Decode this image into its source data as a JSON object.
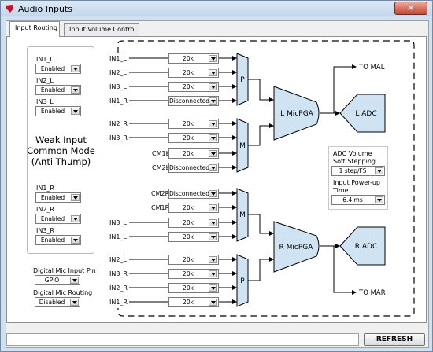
{
  "window": {
    "title": "Audio Inputs",
    "close_glyph": "✕"
  },
  "tabs": [
    {
      "label": "Input Routing",
      "active": true
    },
    {
      "label": "Input Volume Control",
      "active": false
    }
  ],
  "left_panel": {
    "channels_top": [
      {
        "label": "IN1_L",
        "value": "Enabled"
      },
      {
        "label": "IN2_L",
        "value": "Enabled"
      },
      {
        "label": "IN3_L",
        "value": "Enabled"
      }
    ],
    "weak_input_text": "Weak Input Common Mode (Anti Thump)",
    "channels_bottom": [
      {
        "label": "IN1_R",
        "value": "Enabled"
      },
      {
        "label": "IN2_R",
        "value": "Enabled"
      },
      {
        "label": "IN3_R",
        "value": "Enabled"
      }
    ],
    "digital_mic_pin": {
      "label": "Digital Mic Input Pin",
      "value": "GPIO"
    },
    "digital_mic_routing": {
      "label": "Digital Mic Routing",
      "value": "Disabled"
    }
  },
  "routing": {
    "inputs": [
      {
        "label": "IN1_L",
        "value": "20k"
      },
      {
        "label": "IN2_L",
        "value": "20k"
      },
      {
        "label": "IN3_L",
        "value": "20k"
      },
      {
        "label": "IN1_R",
        "value": "Disconnected"
      },
      {
        "label": "IN2_R",
        "value": "20k"
      },
      {
        "label": "IN3_R",
        "value": "20k"
      },
      {
        "label": "CM1L",
        "value": "20k"
      },
      {
        "label": "CM2L",
        "value": "Disconnected"
      },
      {
        "label": "CM2R",
        "value": "Disconnected"
      },
      {
        "label": "CM1R",
        "value": "20k"
      },
      {
        "label": "IN3_L",
        "value": "20k"
      },
      {
        "label": "IN1_L",
        "value": "20k"
      },
      {
        "label": "IN2_L",
        "value": "20k"
      },
      {
        "label": "IN3_R",
        "value": "20k"
      },
      {
        "label": "IN2_R",
        "value": "20k"
      },
      {
        "label": "IN1_R",
        "value": "20k"
      }
    ]
  },
  "blocks": {
    "mux_p": "P",
    "mux_m": "M",
    "l_micpga": "L MicPGA",
    "r_micpga": "R MicPGA",
    "l_adc": "L ADC",
    "r_adc": "R ADC",
    "to_mal": "TO MAL",
    "to_mar": "TO MAR"
  },
  "adc_settings": {
    "soft_step_label": "ADC Volume Soft Stepping",
    "soft_step_value": "1 step/FS",
    "powerup_label": "Input Power-up Time",
    "powerup_value": "6.4 ms"
  },
  "footer": {
    "status_text": "",
    "refresh_label": "REFRESH"
  }
}
